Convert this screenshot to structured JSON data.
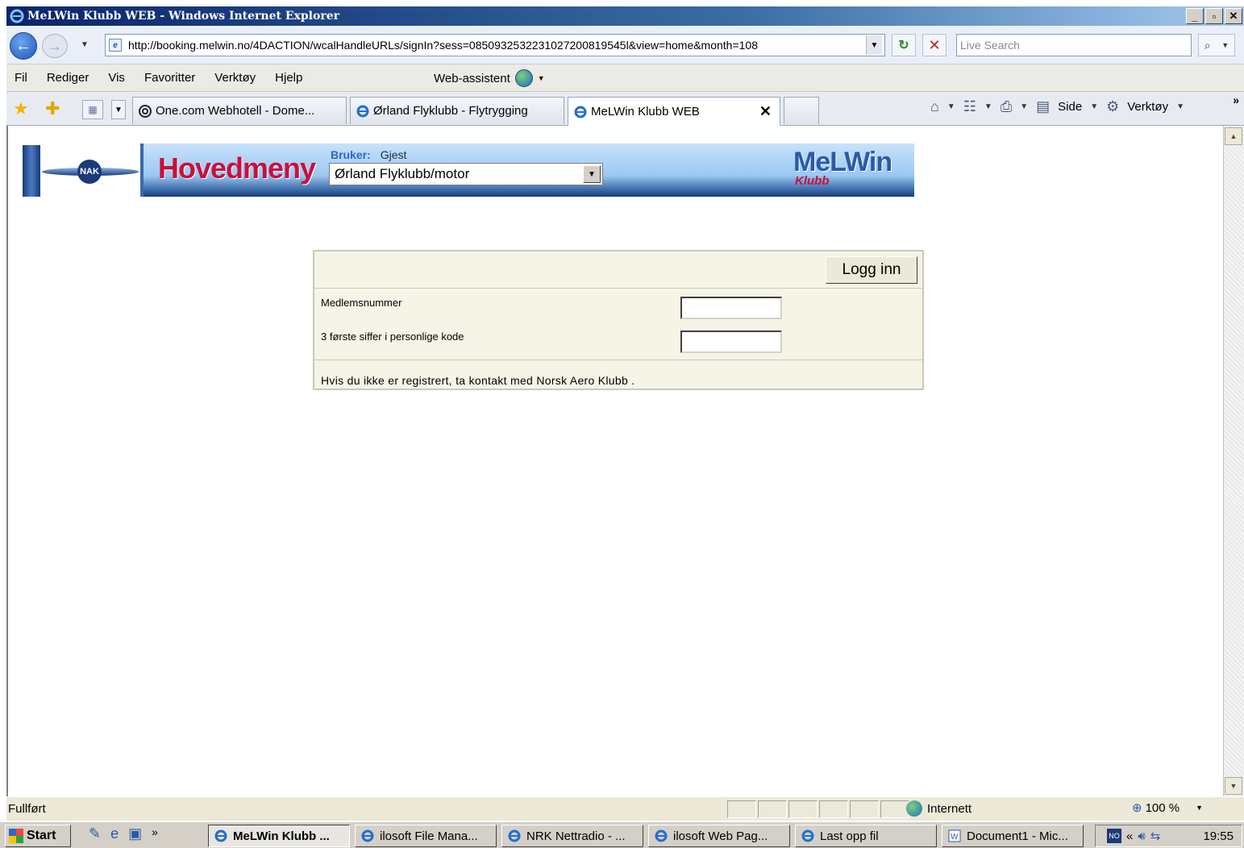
{
  "window": {
    "title": "MeLWin Klubb WEB - Windows Internet Explorer",
    "min": "_",
    "max": "▫",
    "close": "✕"
  },
  "address": {
    "url": "http://booking.melwin.no/4DACTION/wcalHandleURLs/signIn?sess=0850932532231027200819545l&view=home&month=108",
    "search_placeholder": "Live Search"
  },
  "menu": {
    "items": [
      "Fil",
      "Rediger",
      "Vis",
      "Favoritter",
      "Verktøy",
      "Hjelp"
    ],
    "web_assistant": "Web-assistent"
  },
  "tabs": [
    {
      "label": "One.com Webhotell  -  Dome..."
    },
    {
      "label": "Ørland Flyklubb - Flytrygging"
    },
    {
      "label": "MeLWin Klubb WEB",
      "active": true
    }
  ],
  "commands": {
    "side": "Side",
    "tools": "Verktøy"
  },
  "header": {
    "logo_letters": "NAK",
    "title": "Hovedmeny",
    "user_label": "Bruker:",
    "user_value": "Gjest",
    "club": "Ørland Flyklubb/motor",
    "brand": "MeLWin",
    "brand_sub": "Klubb"
  },
  "login": {
    "button": "Logg inn",
    "member_label": "Medlemsnummer",
    "code_label": "3 første siffer i personlige kode",
    "member_value": "",
    "code_value": "",
    "note": "Hvis du ikke er registrert, ta kontakt med Norsk Aero Klubb ."
  },
  "status": {
    "text": "Fullført",
    "zone": "Internett",
    "zoom": "100 %"
  },
  "taskbar": {
    "start": "Start",
    "tasks": [
      {
        "label": "MeLWin Klubb ...",
        "active": true
      },
      {
        "label": "ilosoft File Mana..."
      },
      {
        "label": "NRK Nettradio - ..."
      },
      {
        "label": "ilosoft Web Pag..."
      },
      {
        "label": "Last opp fil"
      },
      {
        "label": "Document1 - Mic..."
      }
    ],
    "tray_box": "NO",
    "clock": "19:55"
  },
  "colors": {
    "brand_red": "#c8103c",
    "brand_blue": "#2a5aa8",
    "form_bg": "#f5f4e6"
  }
}
